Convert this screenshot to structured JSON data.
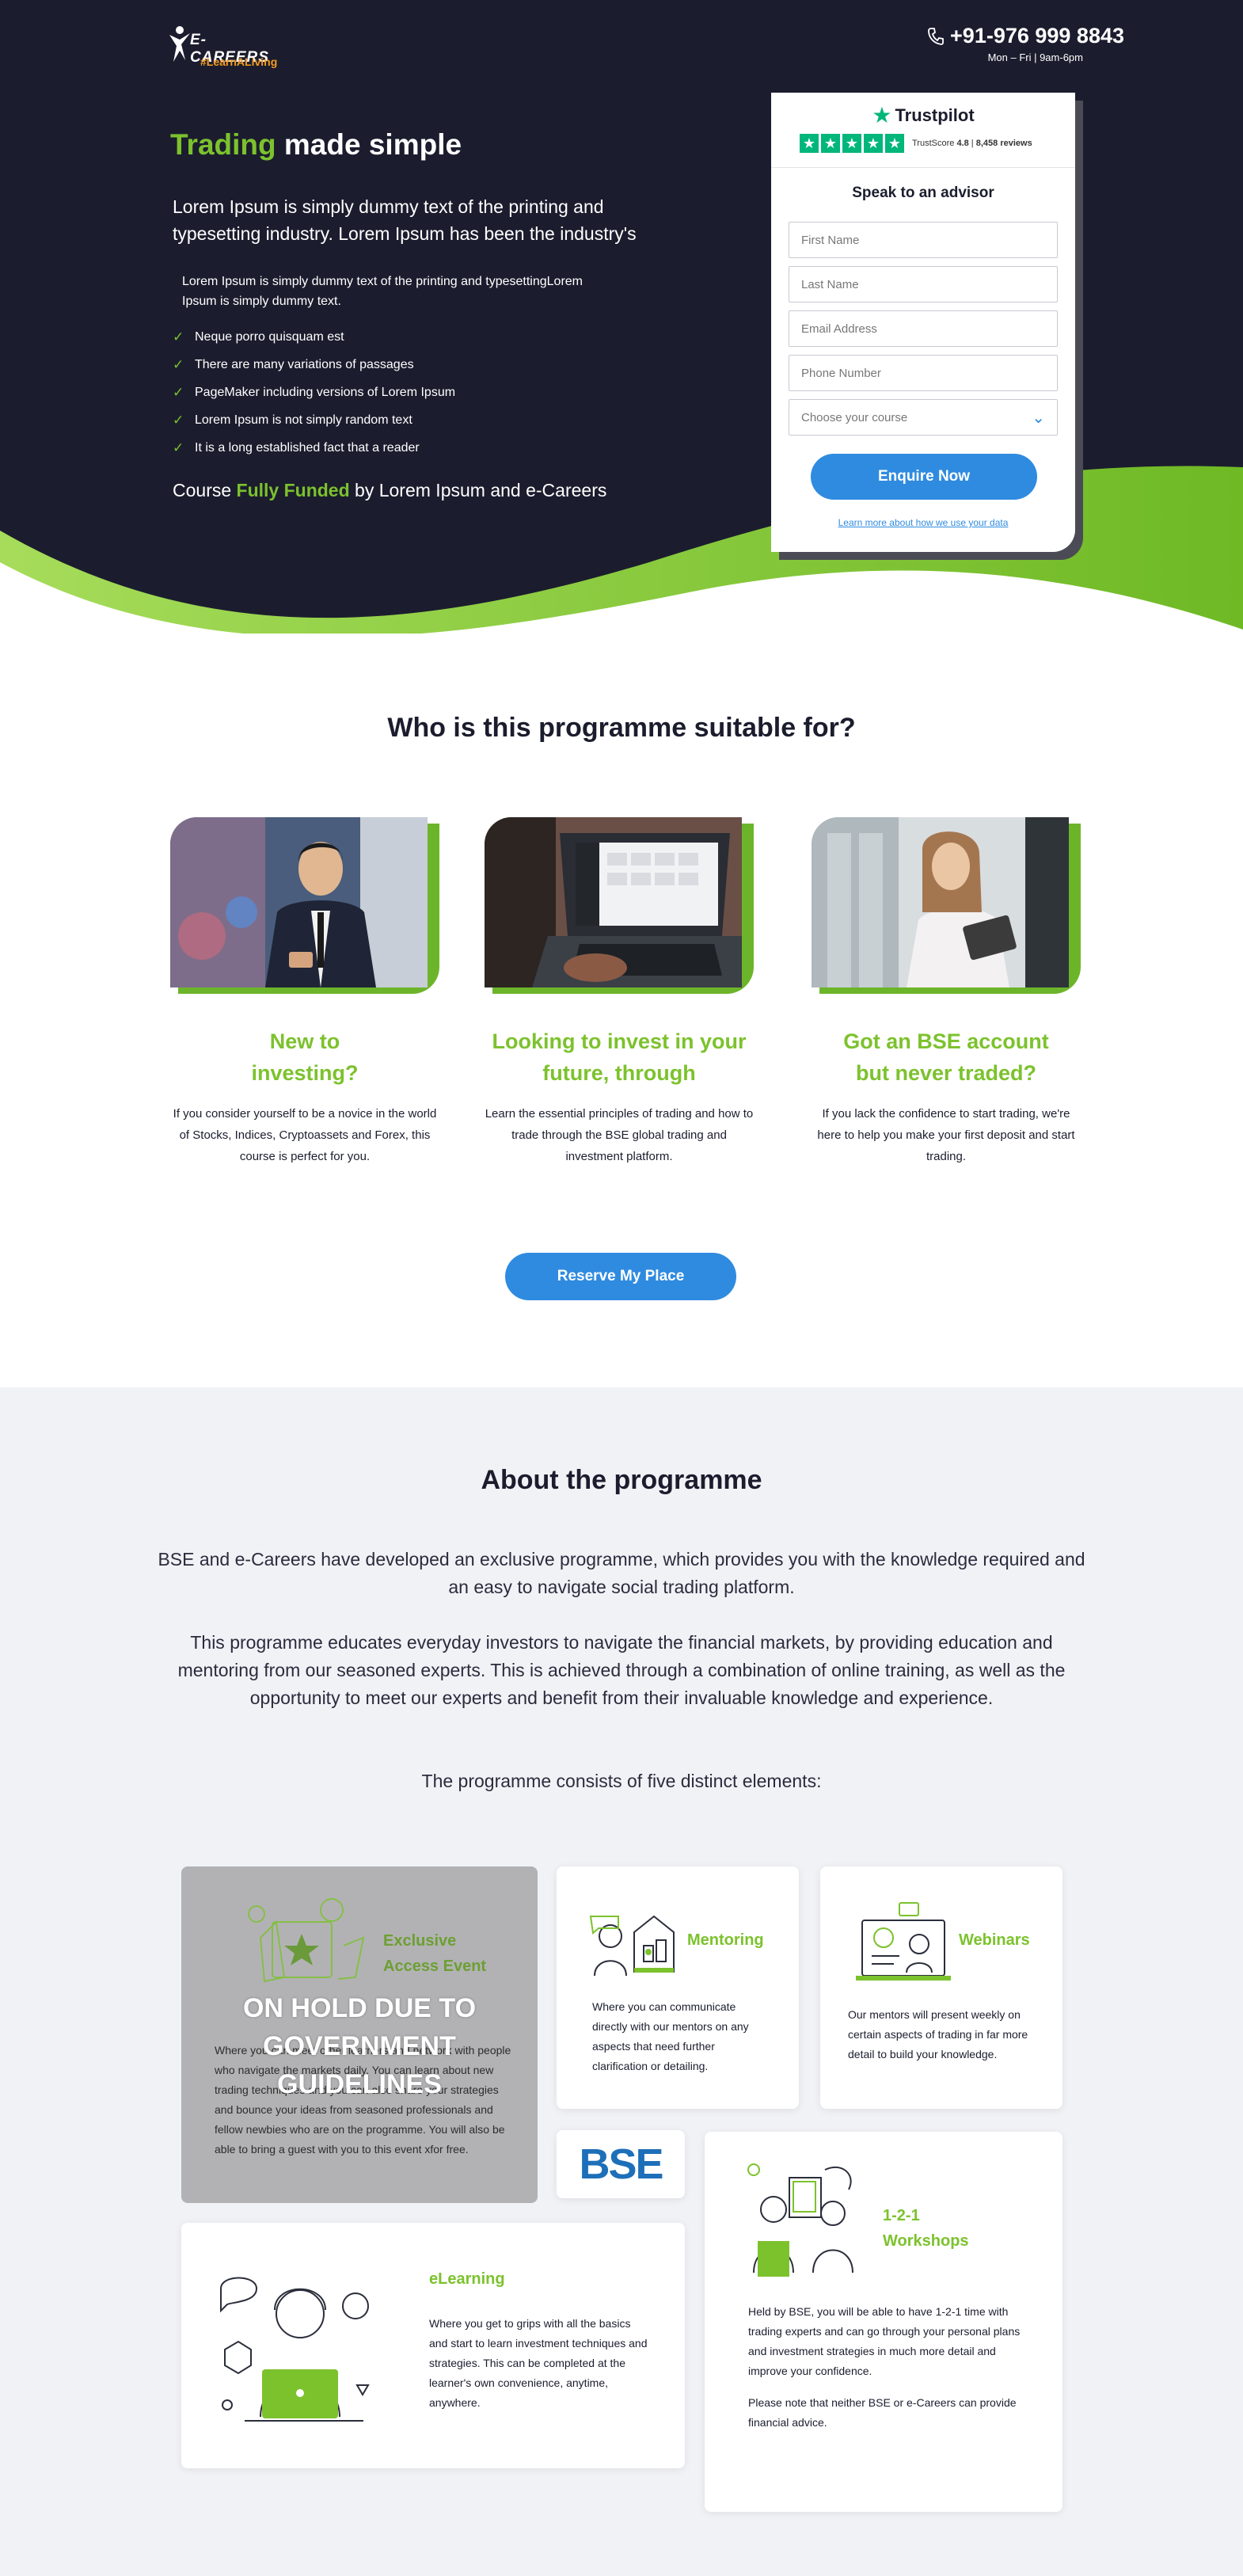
{
  "brand": {
    "logo_text": "E-CAREERS",
    "logo_tagline": "#LearnALiving",
    "accent_green": "#7cc22d",
    "accent_blue": "#2f8be0",
    "dark_bg": "#1b1d2e"
  },
  "contact": {
    "phone": "+91-976 999 8843",
    "hours": "Mon – Fri | 9am-6pm",
    "icon": "phone-icon"
  },
  "hero": {
    "title_green": "Trading",
    "title_rest": " made simple",
    "lead": "Lorem Ipsum is simply dummy text of the printing and typesetting industry. Lorem Ipsum has been the industry's",
    "sub": "Lorem Ipsum is simply dummy text of the printing and typesettingLorem Ipsum is simply dummy text.",
    "bullets": [
      "Neque porro quisquam est",
      "There are many variations of passages",
      "PageMaker including versions of Lorem Ipsum",
      "Lorem Ipsum is not simply random text",
      "It is a long established fact that a reader"
    ],
    "funded_pre": "Course ",
    "funded_green": "Fully Funded",
    "funded_post": " by Lorem Ipsum and e-Careers"
  },
  "form": {
    "trustpilot_label": "Trustpilot",
    "trustscore_label": "TrustScore",
    "trustscore_value": "4.8",
    "reviews": "8,458 reviews",
    "rating_stars": 5,
    "heading": "Speak to an advisor",
    "first_name_placeholder": "First Name",
    "last_name_placeholder": "Last Name",
    "email_placeholder": "Email Address",
    "phone_placeholder": "Phone Number",
    "course_select": "Choose your course",
    "submit_label": "Enquire Now",
    "data_link": "Learn more about how we use your data"
  },
  "suitable": {
    "title": "Who is this programme suitable for?",
    "cards": [
      {
        "title_line1": "New to",
        "title_line2": "investing?",
        "text": "If you consider yourself to be a novice in the world of Stocks, Indices, Cryptoassets and Forex, this course is perfect for you."
      },
      {
        "title_line1": "Looking to invest in your",
        "title_line2": "future, through",
        "text": "Learn the essential principles of trading and how to trade through the BSE global trading and investment platform."
      },
      {
        "title_line1": "Got an BSE account",
        "title_line2": "but never traded?",
        "text": "If you lack the confidence to start trading, we're here to help you make your first deposit and start trading."
      }
    ],
    "cta_label": "Reserve My Place"
  },
  "about": {
    "title": "About the programme",
    "p1": "BSE and e-Careers have developed an exclusive programme, which provides you with the knowledge required and an easy to navigate social trading platform.",
    "p2": "This programme educates everyday investors to navigate the financial markets, by providing education and mentoring from our seasoned experts. This is achieved through a combination of online training, as well as the opportunity to meet our experts and benefit from their invaluable knowledge and experience.",
    "p3": "The programme consists of five distinct elements:",
    "exclusive": {
      "title": "Exclusive Access Event",
      "overlay": "ON HOLD DUE TO GOVERNMENT GUIDELINES",
      "text": "Where you can meet other learners and network with people who navigate the markets daily. You can learn about new trading techniques and you can also share your strategies and bounce your ideas from seasoned professionals and fellow newbies who are on the programme. You will also be able to bring a guest with you to this event xfor free."
    },
    "mentoring": {
      "title": "Mentoring",
      "text": "Where you can communicate directly with our mentors on any aspects that need further clarification or detailing."
    },
    "webinars": {
      "title": "Webinars",
      "text": "Our mentors will present weekly on certain aspects of trading in far more detail to build your knowledge."
    },
    "bse_logo": "BSE",
    "workshops": {
      "title": "1-2-1 Workshops",
      "text": "Held by BSE, you will be able to have 1-2-1 time with trading experts and can go through your personal plans and investment strategies in much more detail and improve your confidence.",
      "note": "Please note that neither BSE or e-Careers can provide financial advice."
    },
    "elearning": {
      "title": "eLearning",
      "text": "Where you get to grips with all the basics and start to learn investment techniques and strategies. This can be completed at the learner's own convenience, anytime, anywhere."
    }
  }
}
